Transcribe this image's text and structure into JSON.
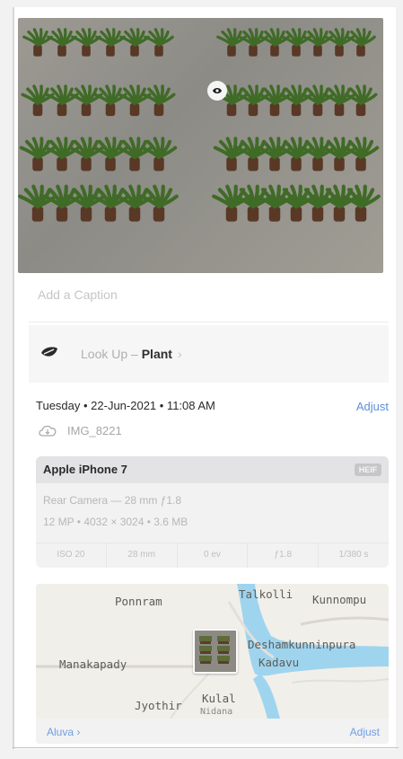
{
  "photo": {
    "alt": "Plant seedlings on concrete"
  },
  "caption": {
    "placeholder": "Add a Caption"
  },
  "lookup": {
    "prefix": "Look Up – ",
    "subject": "Plant",
    "chevron": "›",
    "icon": "leaf-lookup-icon"
  },
  "info": {
    "datetime": "Tuesday • 22-Jun-2021 • 11:08 AM",
    "adjust_label": "Adjust",
    "filename": "IMG_8221",
    "cloud_icon": "cloud-icon"
  },
  "device": {
    "name": "Apple iPhone 7",
    "format_badge": "HEIF",
    "lens": "Rear Camera — 28 mm ƒ1.8",
    "details": "12 MP • 4032 × 3024 • 3.6 MB",
    "exif": [
      "ISO 20",
      "28 mm",
      "0 ev",
      "ƒ1.8",
      "1/380 s"
    ]
  },
  "map": {
    "labels": [
      "Ponnram",
      "Talkolli",
      "Kunnompu",
      "Deshamkunninpura",
      "Kadavu",
      "Manakapady",
      "Jyothir",
      "Kulal",
      "Nidana"
    ],
    "place": "Aluva ›",
    "adjust_label": "Adjust"
  },
  "colors": {
    "accent": "#5b8fdc",
    "water": "#9fd4ef"
  }
}
